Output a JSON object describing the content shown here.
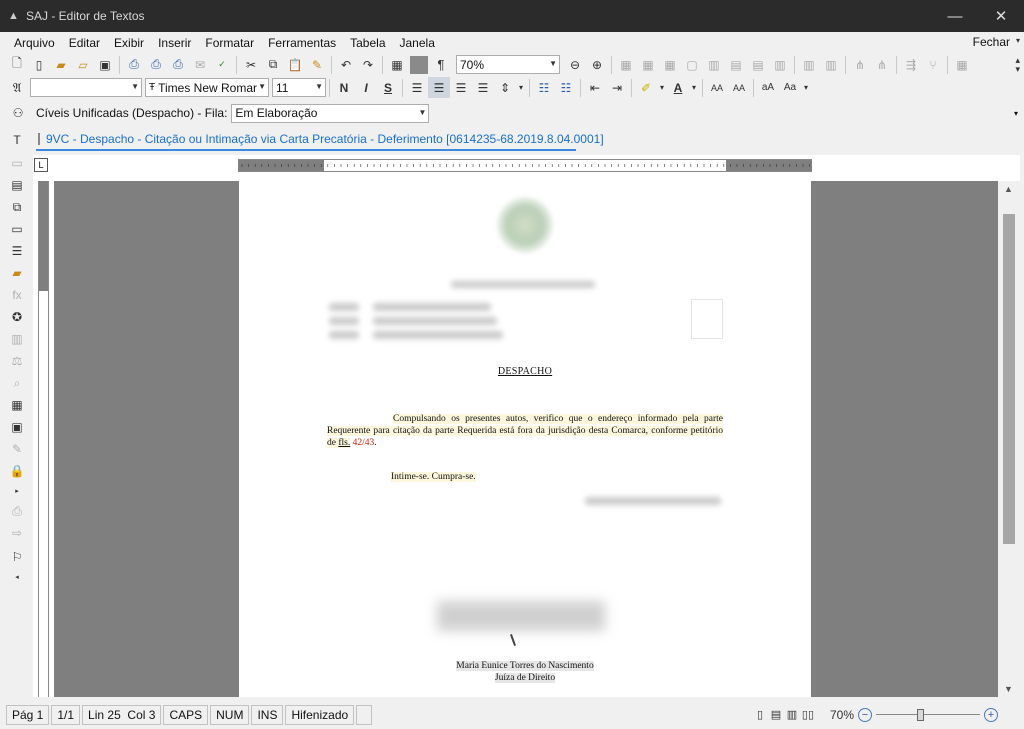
{
  "window": {
    "title": "SAJ - Editor de Textos",
    "minimize_glyph": "—",
    "close_glyph": "✕"
  },
  "menu": {
    "items": [
      "Arquivo",
      "Editar",
      "Exibir",
      "Inserir",
      "Formatar",
      "Ferramentas",
      "Tabela",
      "Janela"
    ],
    "close_label": "Fechar"
  },
  "toolbar1": {
    "zoom_value": "70%"
  },
  "toolbar2": {
    "font_style_value": "",
    "font_name": "Times New Romar",
    "font_size": "11",
    "bold_glyph": "N",
    "italic_glyph": "I",
    "underline_glyph": "S"
  },
  "queue": {
    "label": "Cíveis Unificadas (Despacho) - Fila:",
    "value": "Em Elaboração"
  },
  "document_tab": {
    "label": "9VC - Despacho - Citação ou Intimação via Carta Precatória - Deferimento [0614235-68.2019.8.04.0001]"
  },
  "page": {
    "heading": "DESPACHO",
    "paragraph_main": "Compulsando os presentes autos, verifico que o endereço informado pela parte Requerente para citação da parte Requerida está fora da jurisdição desta Comarca, conforme petitório de ",
    "paragraph_fls": "fls.",
    "paragraph_pages": "42/43",
    "paragraph_end": ".",
    "intimation": "Intime-se. Cumpra-se.",
    "signer_name": "Maria Eunice Torres do Nascimento",
    "signer_role": "Juíza de Direito"
  },
  "status": {
    "page": "Pág 1",
    "page_of": "1/1",
    "line_col": "Lin 25  Col 3",
    "caps": "CAPS",
    "num": "NUM",
    "ins": "INS",
    "hyphen": "Hifenizado",
    "zoom": "70%",
    "zoom_level_pct": 70
  },
  "icons": {
    "toolbar1": [
      "new-doc-icon",
      "blank-doc-icon",
      "open-folder-icon",
      "open-recent-icon",
      "save-icon",
      "print-icon",
      "print-preview-icon",
      "print-setup-icon",
      "email-icon",
      "spellcheck-icon",
      "cut-icon",
      "copy-icon",
      "paste-icon",
      "format-painter-icon",
      "undo-icon",
      "redo-icon",
      "table-icon",
      "color-block-icon",
      "pilcrow-icon",
      "zoom-out-icon",
      "zoom-in-icon"
    ],
    "toolbar2": [
      "styles-icon",
      "align-left-icon",
      "align-center-icon",
      "align-right-icon",
      "justify-icon",
      "line-spacing-icon",
      "bullet-list-icon",
      "numbered-list-icon",
      "indent-decrease-icon",
      "indent-increase-icon",
      "highlight-icon",
      "font-color-icon"
    ]
  }
}
